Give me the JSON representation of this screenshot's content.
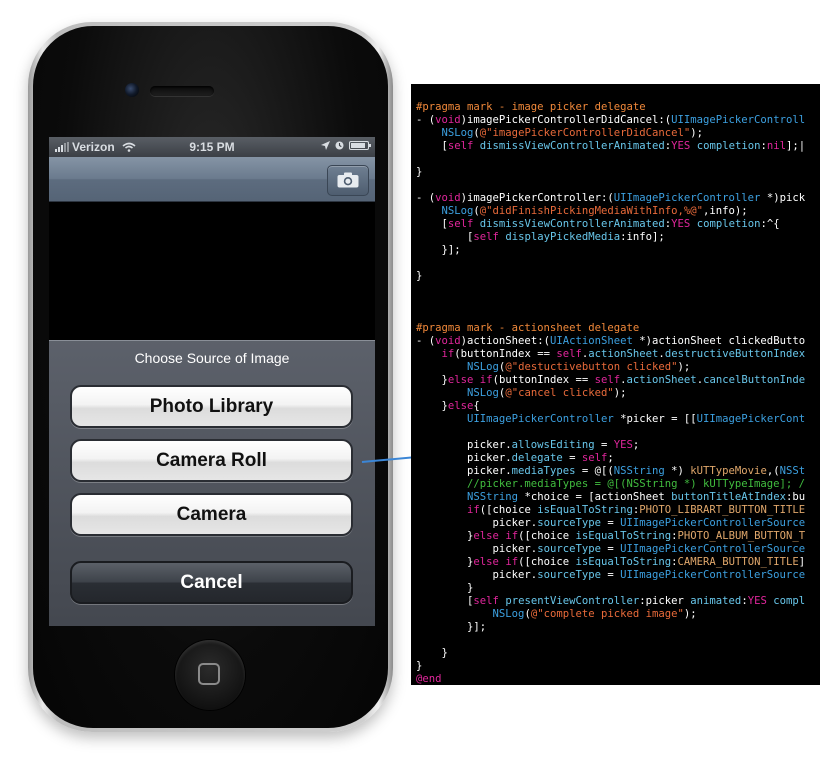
{
  "status_bar": {
    "carrier": "Verizon",
    "time": "9:15 PM"
  },
  "action_sheet": {
    "title": "Choose Source of Image",
    "buttons": [
      "Photo Library",
      "Camera Roll",
      "Camera"
    ],
    "cancel": "Cancel"
  },
  "icons": {
    "nav_button": "camera-icon",
    "status": [
      "signal-icon",
      "wifi-icon",
      "location-icon",
      "lock-icon",
      "battery-icon"
    ]
  },
  "code_colors": {
    "keyword": "#e0269b",
    "type": "#3ca0e0",
    "string": "#e86a3a",
    "comment": "#41bd3f",
    "pragma": "#f0883a"
  },
  "code_lines": [
    [
      [
        "#pragma mark - image picker delegate",
        "pm"
      ]
    ],
    [
      [
        "- (",
        "t"
      ],
      [
        "void",
        "kw"
      ],
      [
        ")imagePickerControllerDidCancel:(",
        "t"
      ],
      [
        "UIImagePickerControll",
        "ty"
      ]
    ],
    [
      [
        "    ",
        "t"
      ],
      [
        "NSLog",
        "ty"
      ],
      [
        "(",
        "t"
      ],
      [
        "@\"imagePickerControllerDidCancel\"",
        "st"
      ],
      [
        ");",
        "t"
      ]
    ],
    [
      [
        "    [",
        "t"
      ],
      [
        "self",
        "kw"
      ],
      [
        " ",
        "t"
      ],
      [
        "dismissViewControllerAnimated",
        "me"
      ],
      [
        ":",
        "t"
      ],
      [
        "YES",
        "kw"
      ],
      [
        " ",
        "t"
      ],
      [
        "completion",
        "me"
      ],
      [
        ":",
        "t"
      ],
      [
        "nil",
        "kw"
      ],
      [
        "];|",
        "t"
      ]
    ],
    [
      [
        "",
        "t"
      ]
    ],
    [
      [
        "}",
        "t"
      ]
    ],
    [
      [
        "",
        "t"
      ]
    ],
    [
      [
        "- (",
        "t"
      ],
      [
        "void",
        "kw"
      ],
      [
        ")imagePickerController:(",
        "t"
      ],
      [
        "UIImagePickerController",
        "ty"
      ],
      [
        " *)pick",
        "t"
      ]
    ],
    [
      [
        "    ",
        "t"
      ],
      [
        "NSLog",
        "ty"
      ],
      [
        "(",
        "t"
      ],
      [
        "@\"didFinishPickingMediaWithInfo,%@\"",
        "st"
      ],
      [
        ",info);",
        "t"
      ]
    ],
    [
      [
        "    [",
        "t"
      ],
      [
        "self",
        "kw"
      ],
      [
        " ",
        "t"
      ],
      [
        "dismissViewControllerAnimated",
        "me"
      ],
      [
        ":",
        "t"
      ],
      [
        "YES",
        "kw"
      ],
      [
        " ",
        "t"
      ],
      [
        "completion",
        "me"
      ],
      [
        ":^{",
        "t"
      ]
    ],
    [
      [
        "        [",
        "t"
      ],
      [
        "self",
        "kw"
      ],
      [
        " ",
        "t"
      ],
      [
        "displayPickedMedia",
        "me"
      ],
      [
        ":info];",
        "t"
      ]
    ],
    [
      [
        "    }];",
        "t"
      ]
    ],
    [
      [
        "",
        "t"
      ]
    ],
    [
      [
        "}",
        "t"
      ]
    ],
    [
      [
        "",
        "t"
      ]
    ],
    [
      [
        "",
        "t"
      ]
    ],
    [
      [
        "",
        "t"
      ]
    ],
    [
      [
        "#pragma mark - actionsheet delegate",
        "pm"
      ]
    ],
    [
      [
        "- (",
        "t"
      ],
      [
        "void",
        "kw"
      ],
      [
        ")actionSheet:(",
        "t"
      ],
      [
        "UIActionSheet",
        "ty"
      ],
      [
        " *)actionSheet clickedButto",
        "t"
      ]
    ],
    [
      [
        "    ",
        "t"
      ],
      [
        "if",
        "kw"
      ],
      [
        "(buttonIndex == ",
        "t"
      ],
      [
        "self",
        "kw"
      ],
      [
        ".",
        "t"
      ],
      [
        "actionSheet",
        "me"
      ],
      [
        ".",
        "t"
      ],
      [
        "destructiveButtonIndex",
        "me"
      ]
    ],
    [
      [
        "        ",
        "t"
      ],
      [
        "NSLog",
        "ty"
      ],
      [
        "(",
        "t"
      ],
      [
        "@\"destuctivebutton clicked\"",
        "st"
      ],
      [
        ");",
        "t"
      ]
    ],
    [
      [
        "    }",
        "t"
      ],
      [
        "else",
        "kw"
      ],
      [
        " ",
        "t"
      ],
      [
        "if",
        "kw"
      ],
      [
        "(buttonIndex == ",
        "t"
      ],
      [
        "self",
        "kw"
      ],
      [
        ".",
        "t"
      ],
      [
        "actionSheet",
        "me"
      ],
      [
        ".",
        "t"
      ],
      [
        "cancelButtonInde",
        "me"
      ]
    ],
    [
      [
        "        ",
        "t"
      ],
      [
        "NSLog",
        "ty"
      ],
      [
        "(",
        "t"
      ],
      [
        "@\"cancel clicked\"",
        "st"
      ],
      [
        ");",
        "t"
      ]
    ],
    [
      [
        "    }",
        "t"
      ],
      [
        "else",
        "kw"
      ],
      [
        "{",
        "t"
      ]
    ],
    [
      [
        "        ",
        "t"
      ],
      [
        "UIImagePickerController",
        "ty"
      ],
      [
        " *picker = [[",
        "t"
      ],
      [
        "UIImagePickerCont",
        "ty"
      ]
    ],
    [
      [
        "",
        "t"
      ]
    ],
    [
      [
        "        picker.",
        "t"
      ],
      [
        "allowsEditing",
        "me"
      ],
      [
        " = ",
        "t"
      ],
      [
        "YES",
        "kw"
      ],
      [
        ";",
        "t"
      ]
    ],
    [
      [
        "        picker.",
        "t"
      ],
      [
        "delegate",
        "me"
      ],
      [
        " = ",
        "t"
      ],
      [
        "self",
        "kw"
      ],
      [
        ";",
        "t"
      ]
    ],
    [
      [
        "        picker.",
        "t"
      ],
      [
        "mediaTypes",
        "me"
      ],
      [
        " = @[(",
        "t"
      ],
      [
        "NSString",
        "ty"
      ],
      [
        " *) ",
        "t"
      ],
      [
        "kUTTypeMovie",
        "mc"
      ],
      [
        ",(",
        "t"
      ],
      [
        "NSSt",
        "ty"
      ]
    ],
    [
      [
        "        ",
        "t"
      ],
      [
        "//picker.mediaTypes = @[(NSString *) kUTTypeImage]; /",
        "cm"
      ]
    ],
    [
      [
        "        ",
        "t"
      ],
      [
        "NSString",
        "ty"
      ],
      [
        " *choice = [actionSheet ",
        "t"
      ],
      [
        "buttonTitleAtIndex",
        "me"
      ],
      [
        ":bu",
        "t"
      ]
    ],
    [
      [
        "        ",
        "t"
      ],
      [
        "if",
        "kw"
      ],
      [
        "([choice ",
        "t"
      ],
      [
        "isEqualToString",
        "me"
      ],
      [
        ":",
        "t"
      ],
      [
        "PHOTO_LIBRART_BUTTON_TITLE",
        "mc"
      ]
    ],
    [
      [
        "            picker.",
        "t"
      ],
      [
        "sourceType",
        "me"
      ],
      [
        " = ",
        "t"
      ],
      [
        "UIImagePickerControllerSource",
        "ty"
      ]
    ],
    [
      [
        "        }",
        "t"
      ],
      [
        "else",
        "kw"
      ],
      [
        " ",
        "t"
      ],
      [
        "if",
        "kw"
      ],
      [
        "([choice ",
        "t"
      ],
      [
        "isEqualToString",
        "me"
      ],
      [
        ":",
        "t"
      ],
      [
        "PHOTO_ALBUM_BUTTON_T",
        "mc"
      ]
    ],
    [
      [
        "            picker.",
        "t"
      ],
      [
        "sourceType",
        "me"
      ],
      [
        " = ",
        "t"
      ],
      [
        "UIImagePickerControllerSource",
        "ty"
      ]
    ],
    [
      [
        "        }",
        "t"
      ],
      [
        "else",
        "kw"
      ],
      [
        " ",
        "t"
      ],
      [
        "if",
        "kw"
      ],
      [
        "([choice ",
        "t"
      ],
      [
        "isEqualToString",
        "me"
      ],
      [
        ":",
        "t"
      ],
      [
        "CAMERA_BUTTON_TITLE",
        "mc"
      ],
      [
        "]",
        "t"
      ]
    ],
    [
      [
        "            picker.",
        "t"
      ],
      [
        "sourceType",
        "me"
      ],
      [
        " = ",
        "t"
      ],
      [
        "UIImagePickerControllerSource",
        "ty"
      ]
    ],
    [
      [
        "        }",
        "t"
      ]
    ],
    [
      [
        "        [",
        "t"
      ],
      [
        "self",
        "kw"
      ],
      [
        " ",
        "t"
      ],
      [
        "presentViewController",
        "me"
      ],
      [
        ":picker ",
        "t"
      ],
      [
        "animated",
        "me"
      ],
      [
        ":",
        "t"
      ],
      [
        "YES",
        "kw"
      ],
      [
        " ",
        "t"
      ],
      [
        "compl",
        "me"
      ]
    ],
    [
      [
        "            ",
        "t"
      ],
      [
        "NSLog",
        "ty"
      ],
      [
        "(",
        "t"
      ],
      [
        "@\"complete picked image\"",
        "st"
      ],
      [
        ");",
        "t"
      ]
    ],
    [
      [
        "        }];",
        "t"
      ]
    ],
    [
      [
        "",
        "t"
      ]
    ],
    [
      [
        "    }",
        "t"
      ]
    ],
    [
      [
        "}",
        "t"
      ]
    ],
    [
      [
        "@end",
        "kw"
      ]
    ]
  ]
}
